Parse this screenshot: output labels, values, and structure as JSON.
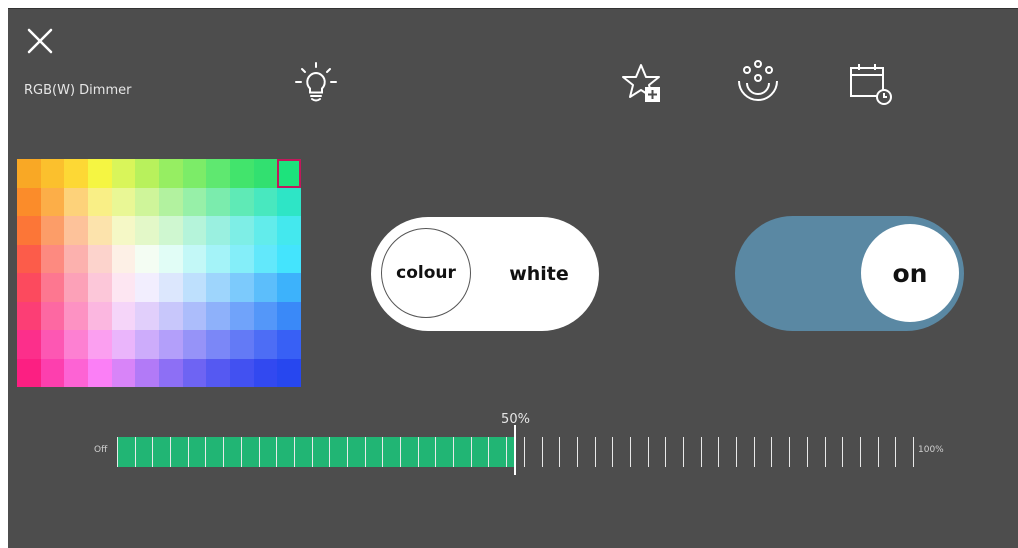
{
  "header": {
    "device_name": "RGB(W) Dimmer",
    "icons": {
      "close": "close-icon",
      "bulb": "bulb-icon",
      "favorite": "star-add-icon",
      "scenes": "scene-icon",
      "schedule": "calendar-clock-icon"
    }
  },
  "palette": {
    "rows": [
      [
        "#f9a825",
        "#fbc02d",
        "#fdd835",
        "#f5f542",
        "#d9f55a",
        "#b8f15c",
        "#96ee62",
        "#7cec68",
        "#5fe870",
        "#42e46c",
        "#32e070",
        "#1de37c"
      ],
      [
        "#fb8c2a",
        "#fcae48",
        "#fdd27a",
        "#f9ef86",
        "#e9f795",
        "#cff59a",
        "#b2f29f",
        "#97f0a8",
        "#7becad",
        "#5feab6",
        "#48e8bf",
        "#2ee5c6"
      ],
      [
        "#fc7637",
        "#fc9d68",
        "#fdc29a",
        "#fce3ac",
        "#f5f8c6",
        "#e3f8c8",
        "#cff7d0",
        "#b5f4da",
        "#9af0e0",
        "#7eeee6",
        "#62eceb",
        "#44e8ee"
      ],
      [
        "#fc5c4a",
        "#fd8a80",
        "#fcb1ae",
        "#fcd3cc",
        "#fdf0e6",
        "#f4fdf3",
        "#e1fdf6",
        "#c3f8f7",
        "#a4f3f8",
        "#84eef9",
        "#62e8fb",
        "#44e4fd"
      ],
      [
        "#fc4a5e",
        "#fd7790",
        "#fca1b8",
        "#fcc7d9",
        "#fde6f2",
        "#f2eefe",
        "#dce7fd",
        "#bee0fd",
        "#9ed5fc",
        "#7ccafc",
        "#5cbefb",
        "#3db2fb"
      ],
      [
        "#fc3e75",
        "#fd68a2",
        "#fd92c3",
        "#fbb7e0",
        "#f5d5f9",
        "#e1cffb",
        "#c8c7fb",
        "#acbdfb",
        "#8eb1fa",
        "#70a3fa",
        "#5497f9",
        "#3a89f8"
      ],
      [
        "#fc2f8b",
        "#fd57b3",
        "#fd80d2",
        "#fb9ff0",
        "#eab5fb",
        "#cdacfb",
        "#b39ffa",
        "#9693f8",
        "#7b87f7",
        "#637af6",
        "#4d6df5",
        "#3860f5"
      ],
      [
        "#fc1f82",
        "#fd3fae",
        "#fd63d4",
        "#fb7ff6",
        "#d884f8",
        "#b27af7",
        "#8d6ff5",
        "#6e64f3",
        "#5559f2",
        "#4251f1",
        "#3249f0",
        "#2747ef"
      ]
    ],
    "selected": {
      "row": 0,
      "col": 11
    }
  },
  "mode_toggle": {
    "option_colour": "colour",
    "option_white": "white",
    "selected": "colour"
  },
  "power_toggle": {
    "state_label": "on",
    "track_color": "#5a88a3"
  },
  "brightness": {
    "value_percent": 50,
    "current_label": "50%",
    "min_label": "Off",
    "max_label": "100%",
    "fill_color": "#21b574"
  }
}
